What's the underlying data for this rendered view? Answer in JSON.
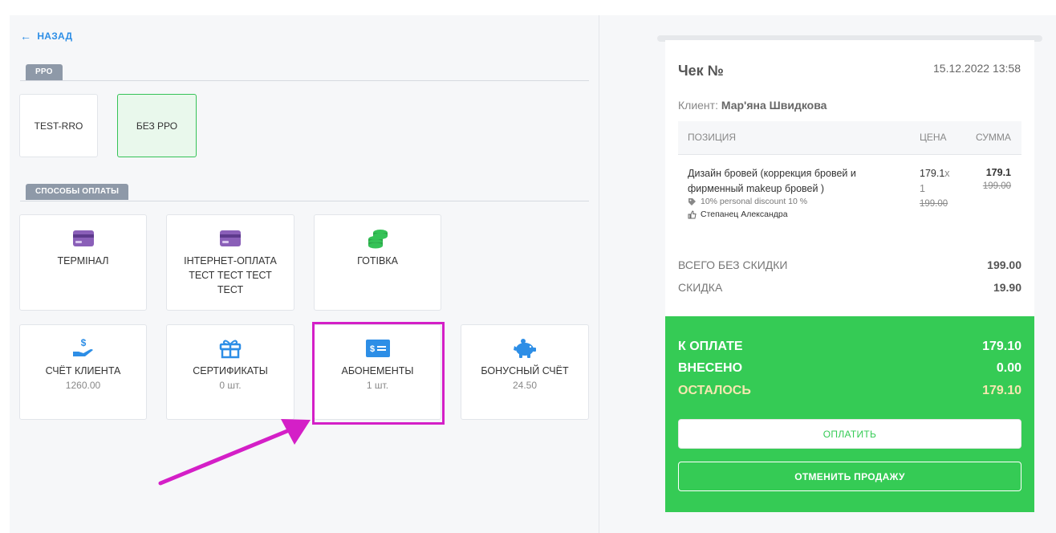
{
  "nav": {
    "back_label": "НАЗАД"
  },
  "prro": {
    "section_title": "РРО",
    "options": [
      {
        "label": "TEST-RRO"
      },
      {
        "label": "БЕЗ РРО"
      }
    ]
  },
  "payment_methods": {
    "section_title": "СПОСОБЫ ОПЛАТЫ",
    "items": [
      {
        "label": "ТЕРМІНАЛ",
        "icon": "card-icon"
      },
      {
        "label": "ІНТЕРНЕТ-ОПЛАТА ТЕСТ ТЕСТ ТЕСТ ТЕСТ",
        "icon": "card-icon"
      },
      {
        "label": "ГОТІВКА",
        "icon": "coins-icon"
      },
      {
        "label": "СЧЁТ КЛИЕНТА",
        "sub": "1260.00",
        "icon": "hand-dollar-icon"
      },
      {
        "label": "СЕРТИФИКАТЫ",
        "sub": "0 шт.",
        "icon": "gift-icon"
      },
      {
        "label": "АБОНЕМЕНТЫ",
        "sub": "1 шт.",
        "icon": "subscription-card-icon"
      },
      {
        "label": "БОНУСНЫЙ СЧЁТ",
        "sub": "24.50",
        "icon": "piggy-bank-icon"
      }
    ]
  },
  "receipt": {
    "title": "Чек №",
    "date": "15.12.2022 13:58",
    "client_label": "Клиент:",
    "client_name": "Мар'яна Швидкова",
    "columns": {
      "position": "ПОЗИЦИЯ",
      "price": "ЦЕНА",
      "sum": "СУММА"
    },
    "item": {
      "name": "Дизайн бровей (коррекция бровей и фирменный makeup бровей )",
      "discount": "10% personal discount 10 %",
      "staff": "Степанец Александра",
      "price": "179.1",
      "qty_mark": "x",
      "qty": "1",
      "price_old": "199.00",
      "sum": "179.1",
      "sum_old": "199.00"
    },
    "totals": {
      "no_discount_label": "ВСЕГО БЕЗ СКИДКИ",
      "no_discount_value": "199.00",
      "discount_label": "СКИДКА",
      "discount_value": "19.90"
    },
    "payment": {
      "to_pay_label": "К ОПЛАТЕ",
      "to_pay_value": "179.10",
      "paid_label": "ВНЕСЕНО",
      "paid_value": "0.00",
      "left_label": "ОСТАЛОСЬ",
      "left_value": "179.10",
      "pay_button": "ОПЛАТИТЬ",
      "cancel_button": "ОТМЕНИТЬ ПРОДАЖУ"
    }
  },
  "colors": {
    "accent_blue": "#2d8ee6",
    "green": "#35cb55",
    "highlight": "#d41fc7",
    "purple_icon": "#8a5fb8"
  }
}
